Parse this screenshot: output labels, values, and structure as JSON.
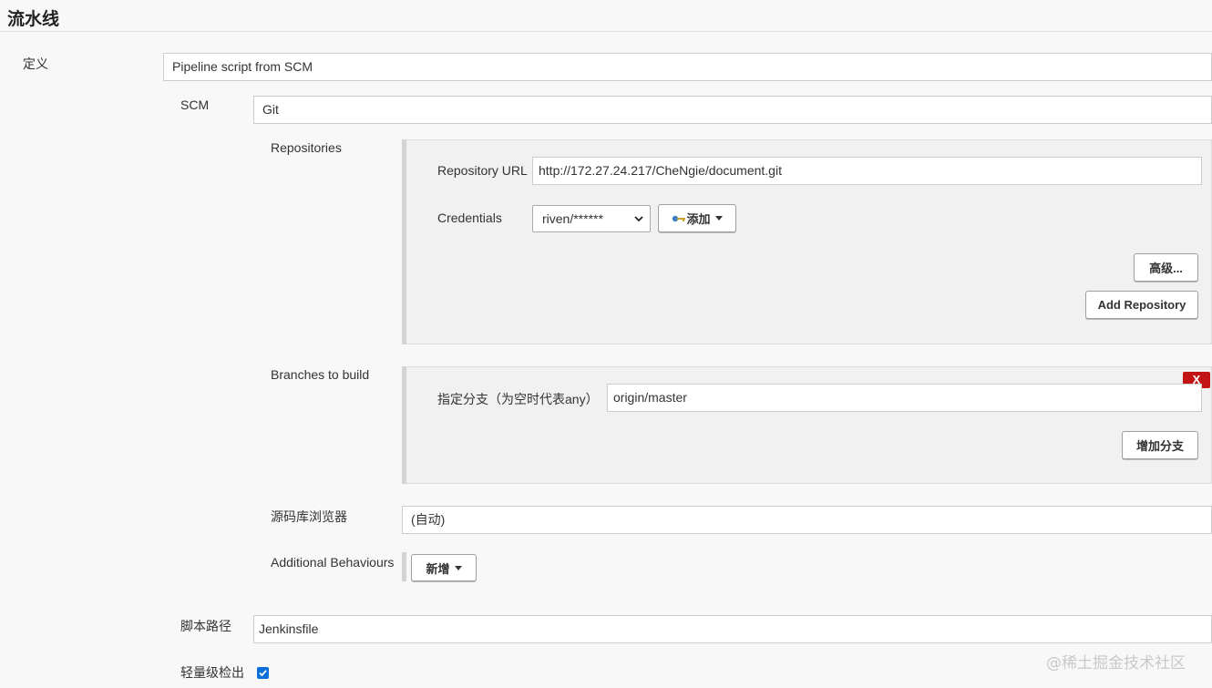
{
  "section_title": "流水线",
  "definition": {
    "label": "定义",
    "value": "Pipeline script from SCM"
  },
  "scm": {
    "label": "SCM",
    "value": "Git"
  },
  "repositories": {
    "label": "Repositories",
    "url_label": "Repository URL",
    "url_value": "http://172.27.24.217/CheNgie/document.git",
    "credentials_label": "Credentials",
    "credentials_value": "riven/******",
    "add_button_label": "添加",
    "advanced_button_label": "高级...",
    "add_repository_button_label": "Add Repository"
  },
  "branches": {
    "label": "Branches to build",
    "delete_label": "X",
    "branch_specifier_label": "指定分支（为空时代表any）",
    "branch_specifier_value": "origin/master",
    "add_branch_button_label": "增加分支"
  },
  "repo_browser": {
    "label": "源码库浏览器",
    "value": "(自动)"
  },
  "additional_behaviours": {
    "label": "Additional Behaviours",
    "button_label": "新增"
  },
  "script_path": {
    "label": "脚本路径",
    "value": "Jenkinsfile"
  },
  "lightweight_checkout": {
    "label": "轻量级检出",
    "checked": true
  },
  "watermark": "@稀土掘金技术社区",
  "colors": {
    "accent": "#0a6fd8",
    "danger": "#c21417"
  }
}
